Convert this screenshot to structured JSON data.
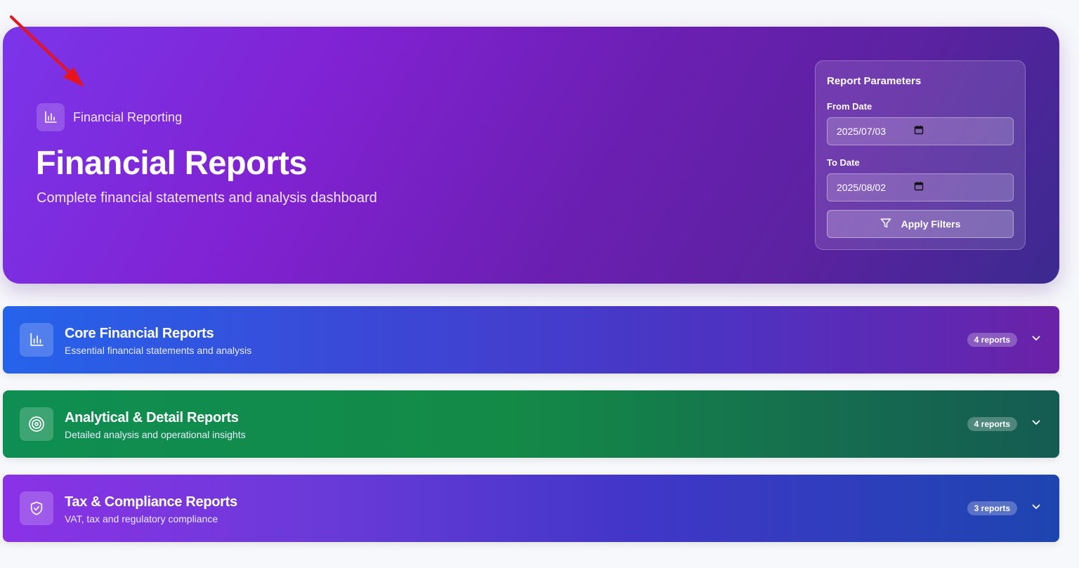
{
  "hero": {
    "eyebrow": "Financial Reporting",
    "eyebrow_icon": "bar-chart-icon",
    "title": "Financial Reports",
    "subtitle": "Complete financial statements and analysis dashboard"
  },
  "params": {
    "title": "Report Parameters",
    "from_label": "From Date",
    "from_value": "2025/07/03",
    "to_label": "To Date",
    "to_value": "2025/08/02",
    "apply_label": "Apply Filters",
    "apply_icon": "filter-icon"
  },
  "categories": [
    {
      "title": "Core Financial Reports",
      "description": "Essential financial statements and analysis",
      "badge": "4 reports",
      "icon": "bar-chart-icon"
    },
    {
      "title": "Analytical & Detail Reports",
      "description": "Detailed analysis and operational insights",
      "badge": "4 reports",
      "icon": "target-icon"
    },
    {
      "title": "Tax & Compliance Reports",
      "description": "VAT, tax and regulatory compliance",
      "badge": "3 reports",
      "icon": "shield-check-icon"
    }
  ],
  "colors": {
    "annotation_arrow": "#e8141c",
    "hero_start": "#7b35ea",
    "hero_end": "#3b2a8f",
    "core_start": "#2563eb",
    "analytical_start": "#0e8e52",
    "tax_start": "#8b32e6"
  }
}
